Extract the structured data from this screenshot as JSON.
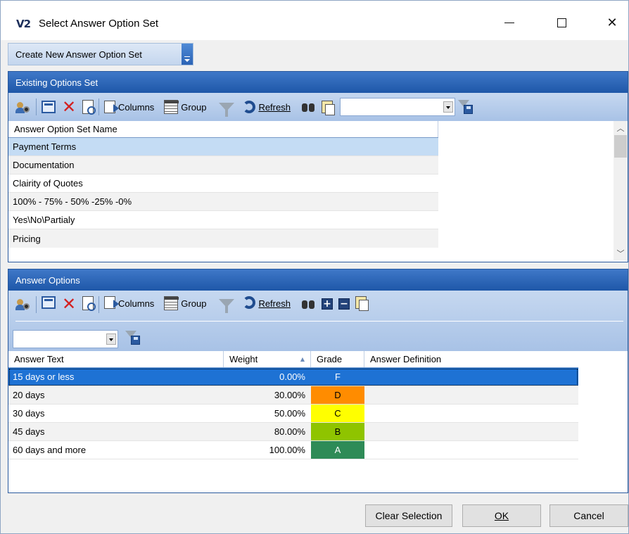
{
  "window": {
    "app_logo": "V2",
    "title": "Select Answer Option Set"
  },
  "create_button": {
    "label": "Create New Answer Option Set"
  },
  "existing": {
    "header": "Existing Options Set",
    "toolbar": {
      "columns": "Columns",
      "group": "Group",
      "refresh": "Refresh"
    },
    "column": "Answer Option Set Name",
    "rows": [
      "Payment Terms",
      "Documentation",
      "Clairity of Quotes",
      "100% - 75% - 50% -25% -0%",
      "Yes\\No\\Partialy",
      "Pricing"
    ]
  },
  "answers": {
    "header": "Answer Options",
    "toolbar": {
      "columns": "Columns",
      "group": "Group",
      "refresh": "Refresh"
    },
    "columns": {
      "text": "Answer Text",
      "weight": "Weight",
      "grade": "Grade",
      "definition": "Answer Definition"
    },
    "rows": [
      {
        "text": "15 days or less",
        "weight": "0.00%",
        "grade": "F",
        "color": "#1e72d4"
      },
      {
        "text": "20 days",
        "weight": "30.00%",
        "grade": "D",
        "color": "#ff8c00"
      },
      {
        "text": "30 days",
        "weight": "50.00%",
        "grade": "C",
        "color": "#ffff00"
      },
      {
        "text": "45 days",
        "weight": "80.00%",
        "grade": "B",
        "color": "#8fc400"
      },
      {
        "text": "60 days and more",
        "weight": "100.00%",
        "grade": "A",
        "color": "#2e8b57"
      }
    ]
  },
  "footer": {
    "clear": "Clear Selection",
    "ok": "OK",
    "cancel": "Cancel"
  }
}
